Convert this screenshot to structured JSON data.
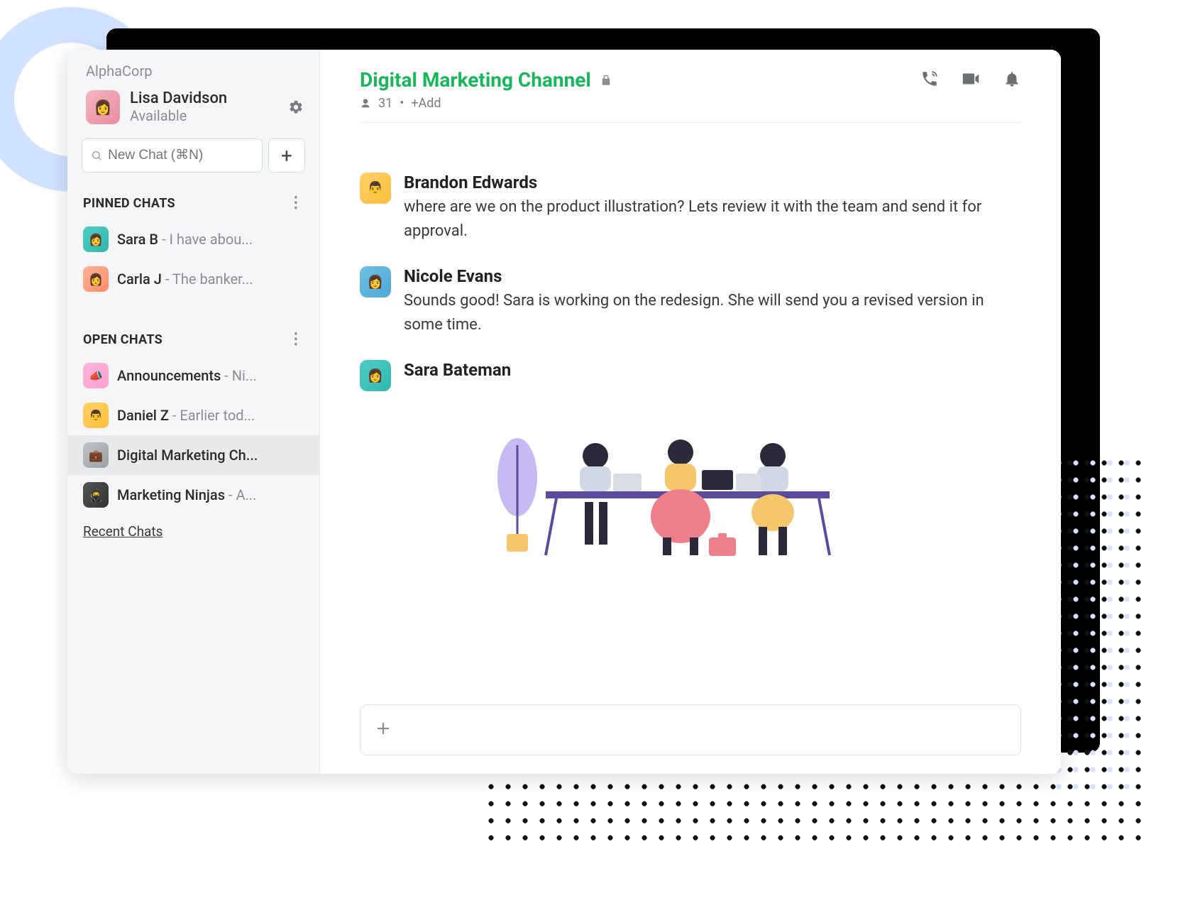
{
  "workspace": "AlphaCorp",
  "profile": {
    "name": "Lisa Davidson",
    "status": "Available"
  },
  "search": {
    "placeholder": "New Chat (⌘N)"
  },
  "sections": {
    "pinned": {
      "title": "PINNED CHATS"
    },
    "open": {
      "title": "OPEN CHATS"
    }
  },
  "pinned_chats": [
    {
      "name": "Sara B",
      "preview": " - I have abou..."
    },
    {
      "name": "Carla J",
      "preview": " - The banker..."
    }
  ],
  "open_chats": [
    {
      "name": "Announcements",
      "preview": " - Ni..."
    },
    {
      "name": "Daniel Z",
      "preview": " - Earlier tod..."
    },
    {
      "name": "Digital Marketing Ch...",
      "preview": ""
    },
    {
      "name": "Marketing Ninjas",
      "preview": " - A..."
    }
  ],
  "recent_link": "Recent Chats",
  "channel": {
    "title": "Digital Marketing Channel",
    "member_count": "31",
    "add_label": "+Add"
  },
  "messages": [
    {
      "name": "Brandon Edwards",
      "text": "where are we on the product illustration? Lets review it with the team and send it for approval."
    },
    {
      "name": "Nicole Evans",
      "text": "Sounds good! Sara is working on the redesign. She will send you a revised version in some time."
    },
    {
      "name": "Sara Bateman",
      "text": ""
    }
  ],
  "composer": {
    "add_label": "+"
  }
}
